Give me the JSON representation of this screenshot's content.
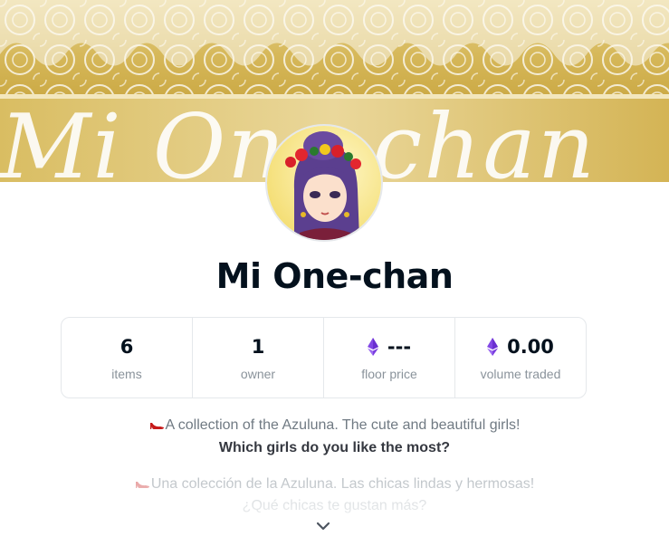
{
  "banner": {
    "script_text": "Mi One-chan"
  },
  "collection": {
    "name": "Mi One-chan"
  },
  "stats": [
    {
      "value": "6",
      "label": "items",
      "eth": false
    },
    {
      "value": "1",
      "label": "owner",
      "eth": false
    },
    {
      "value": "---",
      "label": "floor price",
      "eth": true
    },
    {
      "value": "0.00",
      "label": "volume traded",
      "eth": true
    }
  ],
  "description": {
    "line1": "A collection of the Azuluna. The cute and beautiful girls!",
    "line2": "Which girls do you like the most?",
    "line3": "Una colección de la Azuluna. Las chicas lindas y hermosas!",
    "line4": "¿Qué chicas te gustan más?"
  },
  "icons": {
    "eth": "ethereum-icon",
    "shoe": "high-heel-icon",
    "expand": "chevron-down-icon"
  },
  "colors": {
    "eth_purple": "#8247e5",
    "gold": "#d8b95a",
    "title": "#04111d",
    "muted": "#8a939b"
  }
}
